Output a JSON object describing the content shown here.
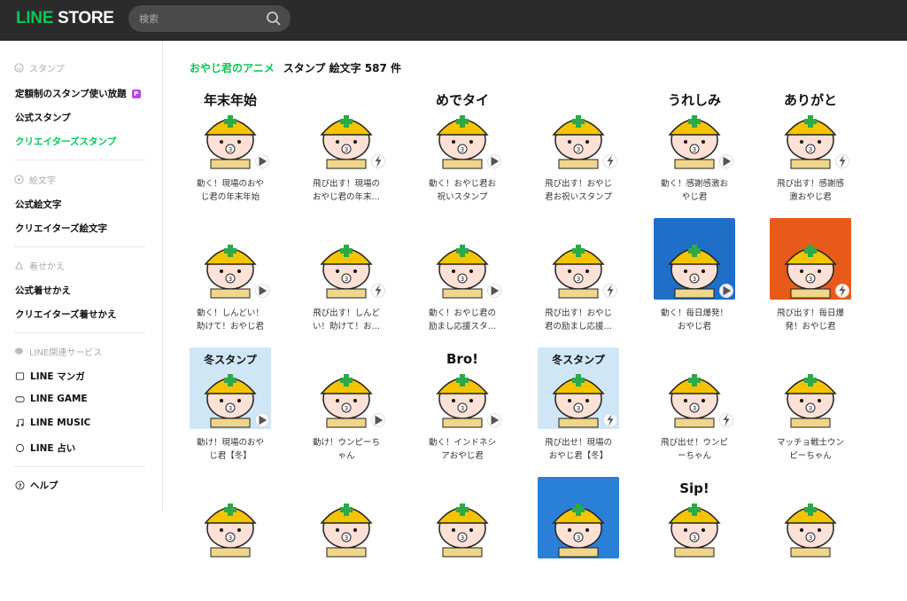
{
  "header": {
    "logo_line": "LINE",
    "logo_store": " STORE",
    "search_placeholder": "検索"
  },
  "sidebar": {
    "sticker_head": "スタンプ",
    "sticker_items": [
      "定額制のスタンプ使い放題",
      "公式スタンプ",
      "クリエイターズスタンプ"
    ],
    "emoji_head": "絵文字",
    "emoji_items": [
      "公式絵文字",
      "クリエイターズ絵文字"
    ],
    "theme_head": "着せかえ",
    "theme_items": [
      "公式着せかえ",
      "クリエイターズ着せかえ"
    ],
    "service_head": "LINE関連サービス",
    "service_items": [
      "LINE マンガ",
      "LINE GAME",
      "LINE MUSIC",
      "LINE 占い"
    ],
    "help": "ヘルプ"
  },
  "main": {
    "creator": "おやじ君のアニメ",
    "summary": "スタンプ 絵文字 587 件"
  },
  "items": [
    {
      "l1": "動く！現場のおや",
      "l2": "じ君の年末年始",
      "badge": "play",
      "text": "年末年始",
      "bg": "#ffffff"
    },
    {
      "l1": "飛び出す！現場の",
      "l2": "おやじ君の年末…",
      "badge": "pop",
      "text": "",
      "bg": "#ffffff"
    },
    {
      "l1": "動く！おやじ君お",
      "l2": "祝いスタンプ",
      "badge": "play",
      "text": "めでタイ",
      "bg": "#ffffff"
    },
    {
      "l1": "飛び出す！おやじ",
      "l2": "君お祝いスタンプ",
      "badge": "pop",
      "text": "",
      "bg": "#ffffff"
    },
    {
      "l1": "動く！感謝感激お",
      "l2": "やじ君",
      "badge": "play",
      "text": "うれしみ",
      "bg": "#ffffff"
    },
    {
      "l1": "飛び出す！感謝感",
      "l2": "激おやじ君",
      "badge": "pop",
      "text": "ありがと",
      "bg": "#ffffff"
    },
    {
      "l1": "動く！しんどい！",
      "l2": "助けて！おやじ君",
      "badge": "play",
      "text": "",
      "bg": "#ffffff"
    },
    {
      "l1": "飛び出す！しんど",
      "l2": "い！助けて！お…",
      "badge": "pop",
      "text": "",
      "bg": "#ffffff"
    },
    {
      "l1": "動く！おやじ君の",
      "l2": "励まし応援スタ…",
      "badge": "play",
      "text": "",
      "bg": "#ffffff"
    },
    {
      "l1": "飛び出す！おやじ",
      "l2": "君の励まし応援…",
      "badge": "pop",
      "text": "",
      "bg": "#ffffff"
    },
    {
      "l1": "動く！毎日爆発！",
      "l2": "おやじ君",
      "badge": "play",
      "text": "",
      "bg": "#1f6fc9"
    },
    {
      "l1": "飛び出す！毎日爆",
      "l2": "発！おやじ君",
      "badge": "pop",
      "text": "",
      "bg": "#e85a1a"
    },
    {
      "l1": "動け！現場のおや",
      "l2": "じ君【冬】",
      "badge": "play",
      "text": "冬スタンプ",
      "bg": "#cfe6f7"
    },
    {
      "l1": "動け！ウンピーち",
      "l2": "ゃん",
      "badge": "play",
      "text": "",
      "bg": "#ffffff"
    },
    {
      "l1": "動く！インドネシ",
      "l2": "アおやじ君",
      "badge": "play",
      "text": "Bro!",
      "bg": "#ffffff"
    },
    {
      "l1": "飛び出せ！現場の",
      "l2": "おやじ君【冬】",
      "badge": "pop",
      "text": "冬スタンプ",
      "bg": "#cfe6f7"
    },
    {
      "l1": "飛び出せ！ウンピ",
      "l2": "ーちゃん",
      "badge": "pop",
      "text": "",
      "bg": "#ffffff"
    },
    {
      "l1": "マッチョ戦士ウン",
      "l2": "ピーちゃん",
      "badge": "",
      "text": "",
      "bg": "#ffffff"
    },
    {
      "l1": "",
      "l2": "",
      "badge": "",
      "text": "",
      "bg": "#ffffff"
    },
    {
      "l1": "",
      "l2": "",
      "badge": "",
      "text": "",
      "bg": "#ffffff"
    },
    {
      "l1": "",
      "l2": "",
      "badge": "",
      "text": "",
      "bg": "#ffffff"
    },
    {
      "l1": "",
      "l2": "",
      "badge": "",
      "text": "",
      "bg": "#2a7fd6"
    },
    {
      "l1": "",
      "l2": "",
      "badge": "",
      "text": "Sip!",
      "bg": "#ffffff"
    },
    {
      "l1": "",
      "l2": "",
      "badge": "",
      "text": "",
      "bg": "#ffffff"
    }
  ],
  "colors": {
    "accent": "#06c755",
    "topbar": "#2b2b2b",
    "helmet": "#f5c400",
    "badge": "#b34be0"
  }
}
